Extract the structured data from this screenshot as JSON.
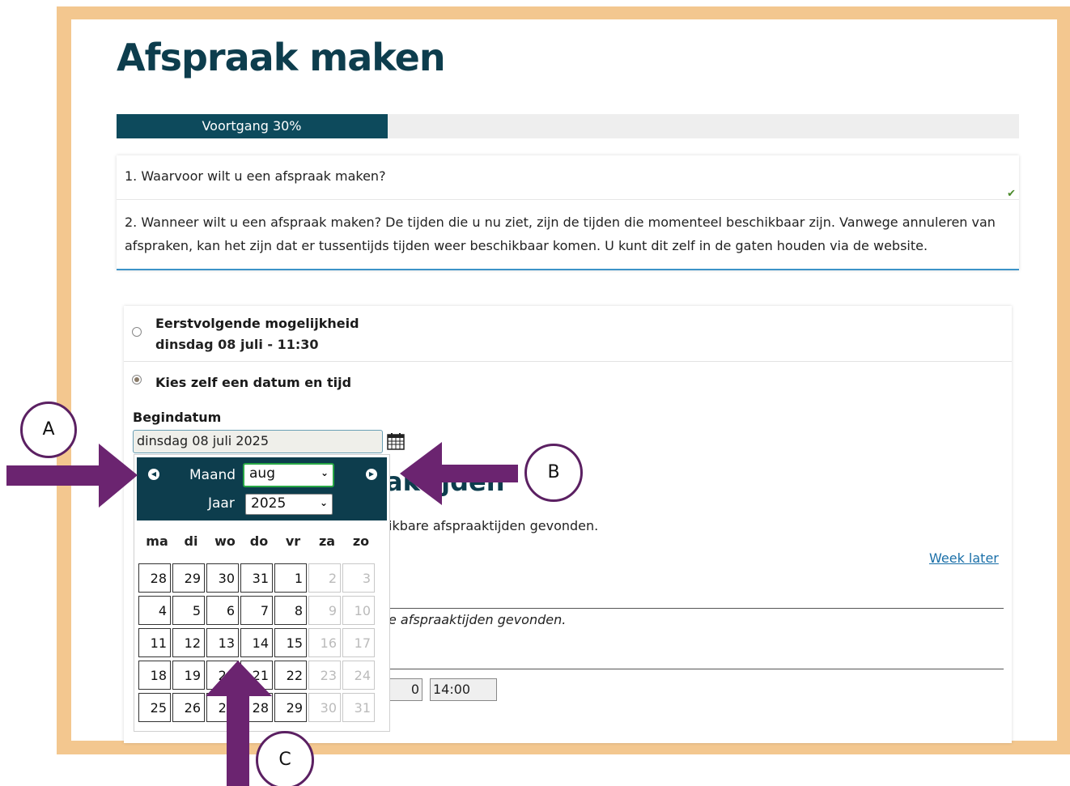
{
  "page": {
    "title": "Afspraak maken"
  },
  "progress": {
    "label": "Voortgang 30%",
    "percent": 30
  },
  "steps": {
    "step1": "1. Waarvoor wilt u een afspraak maken?",
    "step2": "2. Wanneer wilt u een afspraak maken? De tijden die u nu ziet, zijn de tijden die momenteel beschikbaar zijn. Vanwege annuleren van afspraken, kan het zijn dat er tussentijds tijden weer beschikbaar komen. U kunt dit zelf in de gaten houden via de website."
  },
  "options": {
    "first": {
      "title": "Eerstvolgende mogelijkheid",
      "subtitle": "dinsdag 08 juli - 11:30",
      "selected": false
    },
    "custom": {
      "title": "Kies zelf een datum en tijd",
      "selected": true
    }
  },
  "begin_date": {
    "label": "Begindatum",
    "value": "dinsdag 08 juli 2025",
    "calendar_icon": "calendar-icon"
  },
  "datepicker": {
    "month_label": "Maand",
    "month_value": "aug",
    "year_label": "Jaar",
    "year_value": "2025",
    "prev_icon": "chevron-left-icon",
    "next_icon": "chevron-right-icon",
    "weekdays": [
      "ma",
      "di",
      "wo",
      "do",
      "vr",
      "za",
      "zo"
    ],
    "weeks": [
      [
        "28",
        "29",
        "30",
        "31",
        "1",
        "2",
        "3"
      ],
      [
        "4",
        "5",
        "6",
        "7",
        "8",
        "9",
        "10"
      ],
      [
        "11",
        "12",
        "13",
        "14",
        "15",
        "16",
        "17"
      ],
      [
        "18",
        "19",
        "20",
        "21",
        "22",
        "23",
        "24"
      ],
      [
        "25",
        "26",
        "27",
        "28",
        "29",
        "30",
        "31"
      ]
    ]
  },
  "background": {
    "heading_fragment": "aktijden",
    "no_times_text": "ikbare afspraaktijden gevonden.",
    "week_later": "Week later",
    "no_times_text_2": "e afspraaktijden gevonden.",
    "time_left": "0",
    "time_right": "14:00"
  },
  "annotations": {
    "a": "A",
    "b": "B",
    "c": "C",
    "arrow_color": "#6b2470"
  }
}
